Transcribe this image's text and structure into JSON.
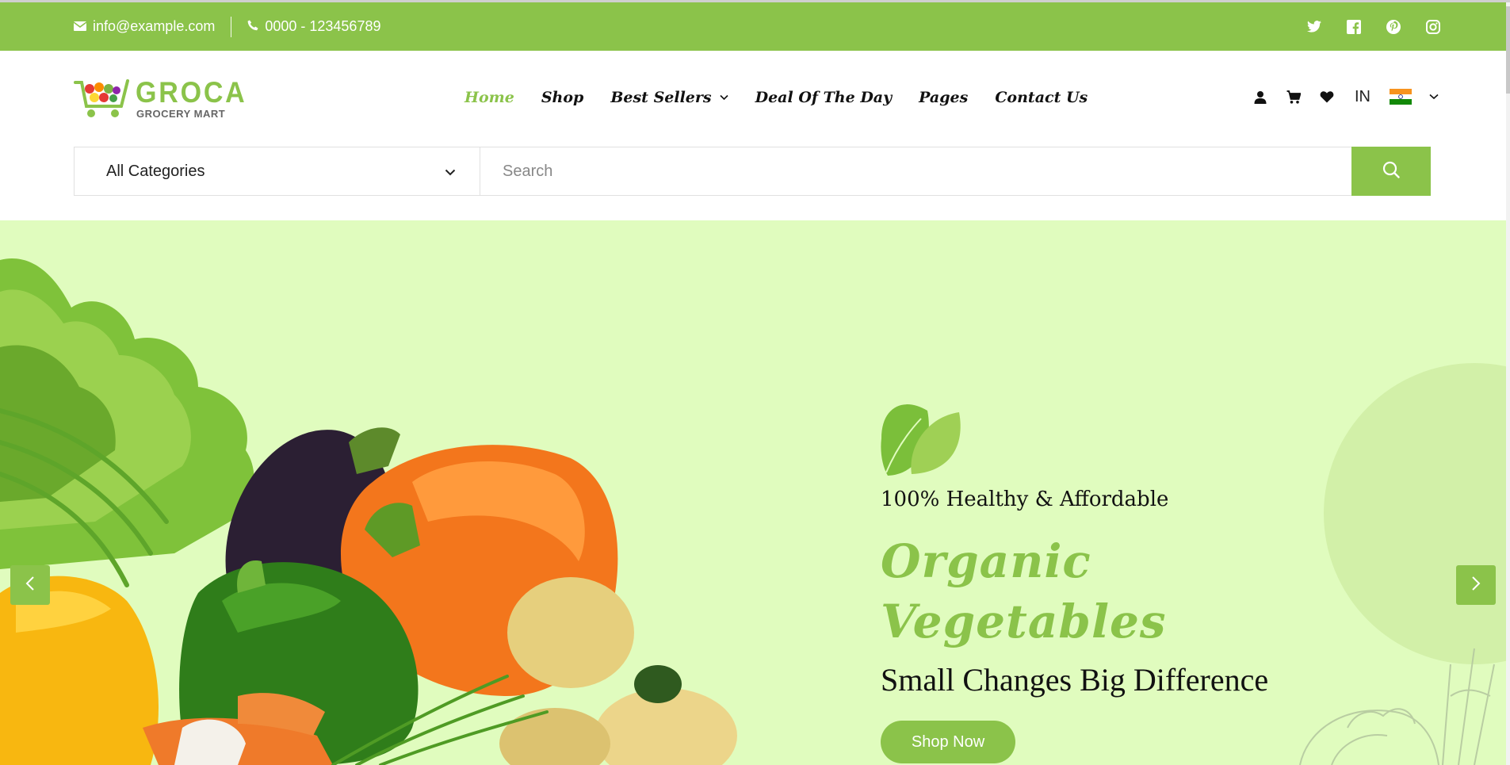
{
  "topbar": {
    "email": "info@example.com",
    "phone": "0000 - 123456789",
    "social": [
      "twitter-icon",
      "facebook-icon",
      "pinterest-icon",
      "instagram-icon"
    ]
  },
  "logo": {
    "brand": "GROCA",
    "sub": "GROCERY MART"
  },
  "nav": {
    "home": "Home",
    "shop": "Shop",
    "best_sellers": "Best Sellers",
    "deal": "Deal Of The Day",
    "pages": "Pages",
    "contact": "Contact Us"
  },
  "header_icons": {
    "language": "IN",
    "icons": [
      "user-icon",
      "cart-icon",
      "heart-icon",
      "india-flag-icon"
    ]
  },
  "search": {
    "category": "All Categories",
    "placeholder": "Search"
  },
  "hero": {
    "tagline": "100% Healthy & Affordable",
    "headline_line1": "Organic",
    "headline_line2": "Vegetables",
    "subline": "Small Changes Big Difference",
    "cta": "Shop Now"
  },
  "colors": {
    "accent": "#8bc34a",
    "hero_bg": "#e0fcbe",
    "text": "#111111"
  }
}
